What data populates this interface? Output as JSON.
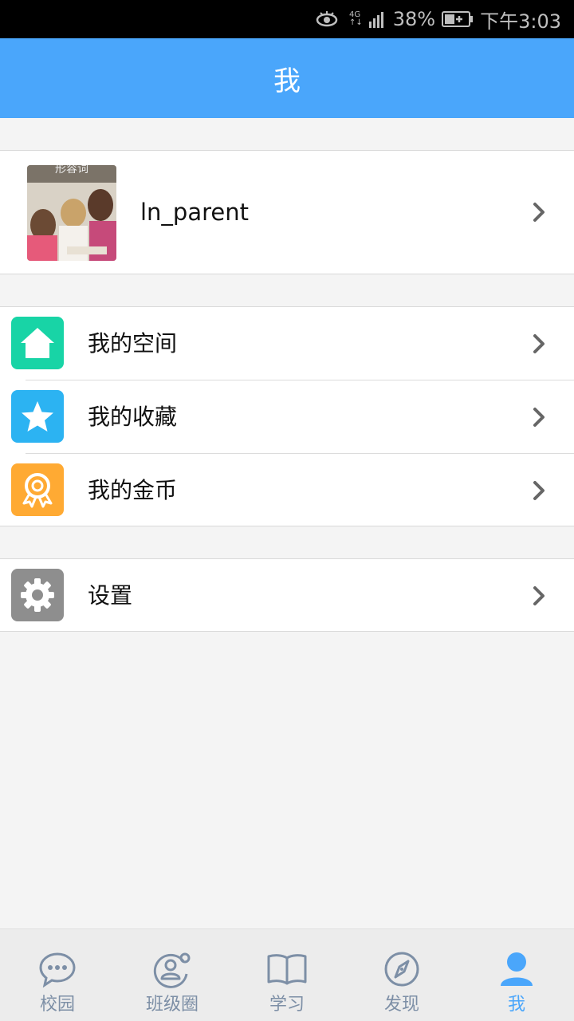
{
  "status_bar": {
    "network": "4G",
    "battery_percent": "38%",
    "time": "下午3:03"
  },
  "header": {
    "title": "我"
  },
  "profile": {
    "avatar_caption": "形容词",
    "username": "ln_parent"
  },
  "menu": {
    "items": [
      {
        "label": "我的空间",
        "icon": "house-icon",
        "color": "#18d4a6"
      },
      {
        "label": "我的收藏",
        "icon": "star-icon",
        "color": "#2cb3f2"
      },
      {
        "label": "我的金币",
        "icon": "medal-icon",
        "color": "#ffaa33"
      }
    ]
  },
  "settings": {
    "label": "设置",
    "icon": "gear-icon",
    "color": "#8e8e8e"
  },
  "bottom_nav": {
    "items": [
      {
        "label": "校园",
        "icon": "chat-bubble-icon"
      },
      {
        "label": "班级圈",
        "icon": "group-circle-icon"
      },
      {
        "label": "学习",
        "icon": "book-icon"
      },
      {
        "label": "发现",
        "icon": "compass-icon"
      },
      {
        "label": "我",
        "icon": "person-icon",
        "active": true
      }
    ]
  },
  "colors": {
    "accent": "#4aa6fb",
    "nav_inactive": "#7d8fa6"
  }
}
